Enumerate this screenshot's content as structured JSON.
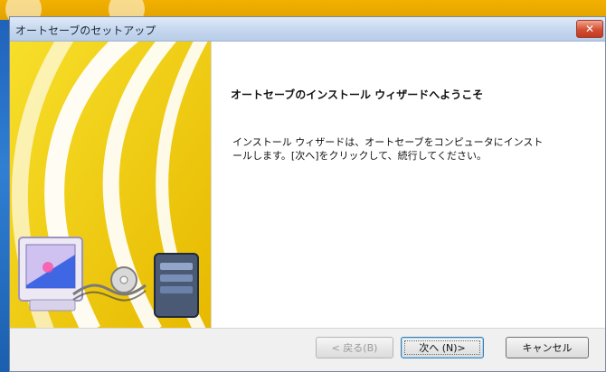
{
  "window": {
    "title": "オートセーブのセットアップ",
    "close_glyph": "✕"
  },
  "content": {
    "heading": "オートセーブのインストール ウィザードへようこそ",
    "body": "インストール ウィザードは、オートセーブをコンピュータにインスト\nールします。[次へ]をクリックして、続行してください。"
  },
  "buttons": {
    "back": "< 戻る(B)",
    "next": "次へ (N)>",
    "cancel": "キャンセル"
  },
  "colors": {
    "banner_yellow": "#f2d000",
    "banner_dark": "#e2b800",
    "accent_blue": "#3c7fb1"
  },
  "icons": {
    "banner_art": "computer-setup-illustration",
    "close": "close-icon"
  }
}
